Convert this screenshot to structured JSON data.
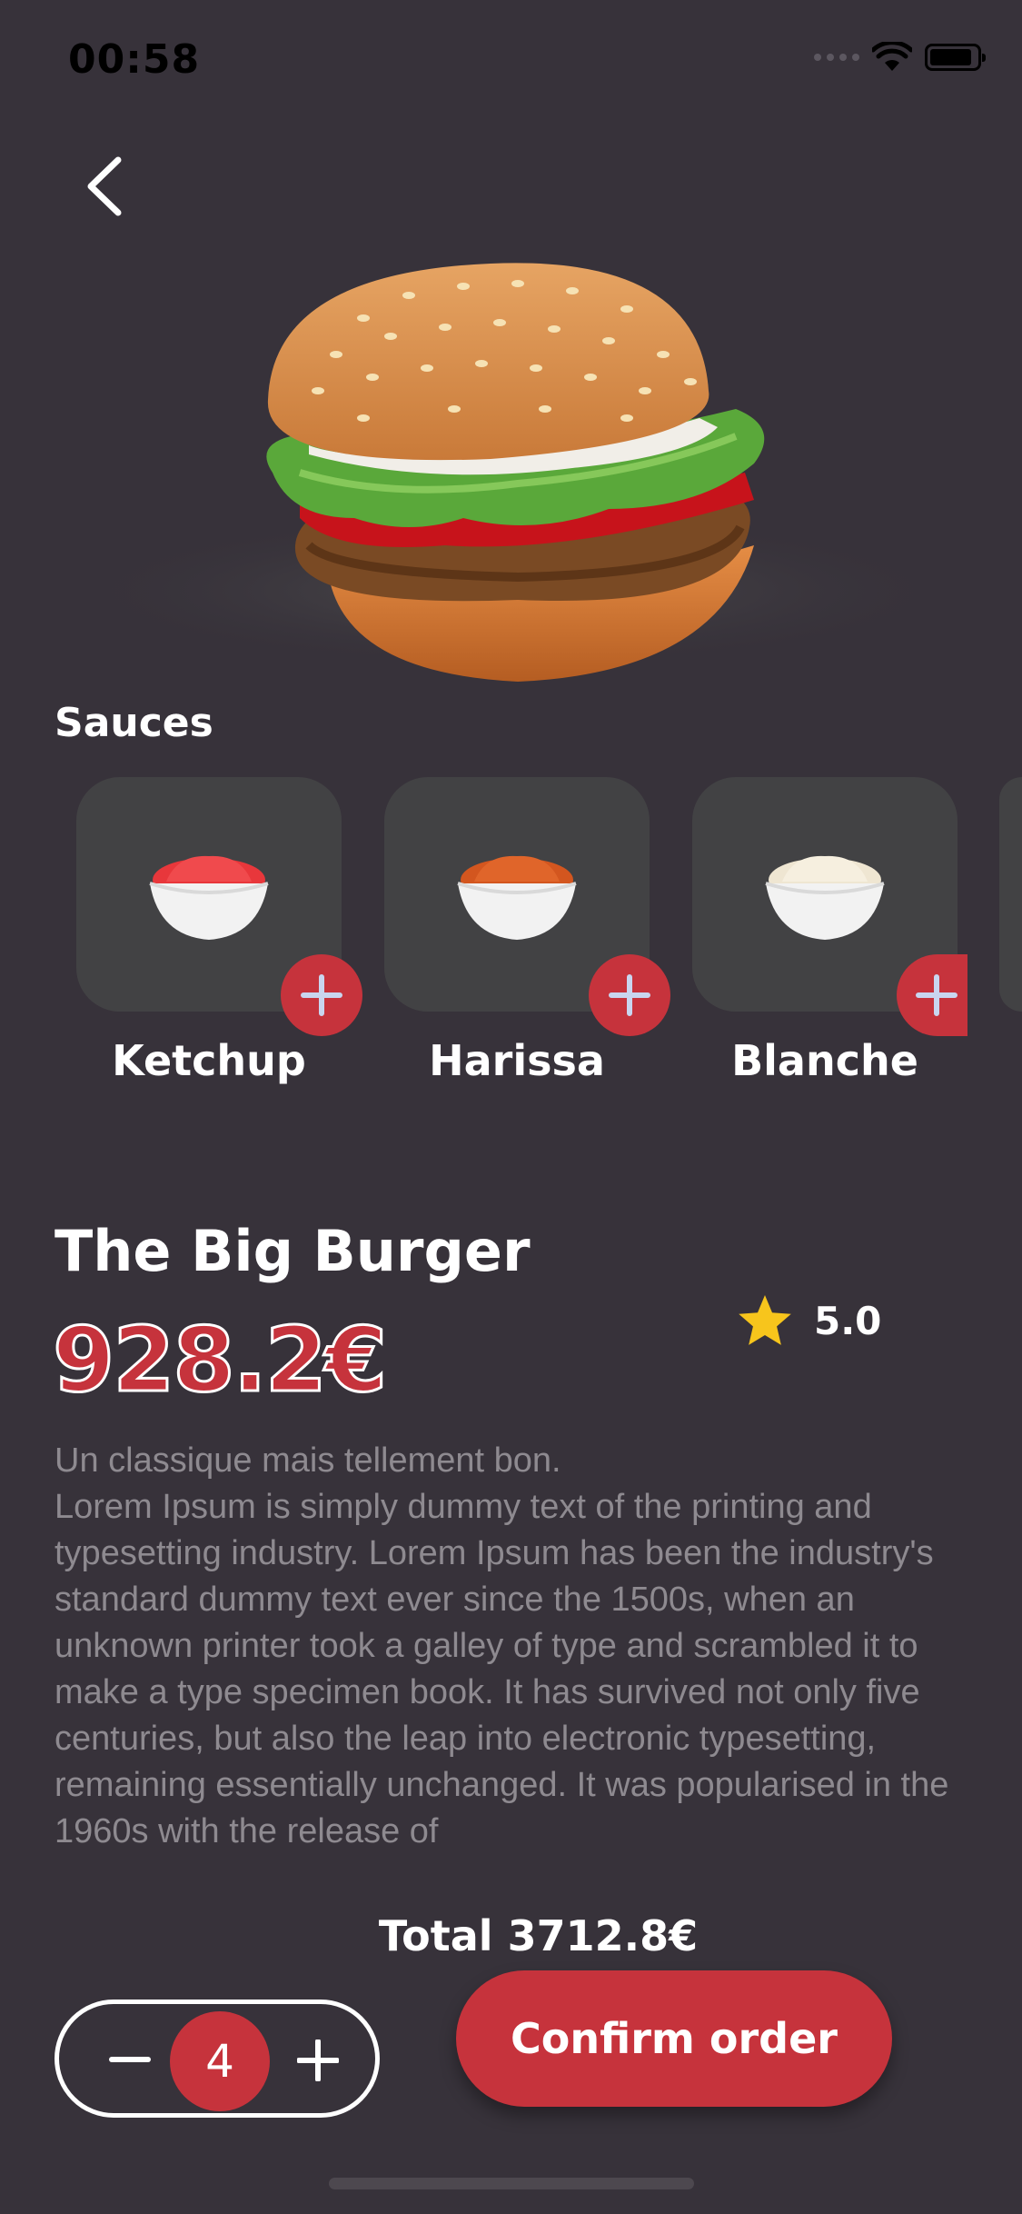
{
  "status_bar": {
    "time": "00:58",
    "icons": [
      "signal-dots-icon",
      "wifi-icon",
      "battery-icon"
    ]
  },
  "nav": {
    "back_icon": "chevron-left-icon"
  },
  "sauces": {
    "title": "Sauces",
    "items": [
      {
        "name": "Ketchup",
        "color": "#e8373b"
      },
      {
        "name": "Harissa",
        "color": "#d3561f"
      },
      {
        "name": "Blanche",
        "color": "#efe6d2"
      }
    ]
  },
  "product": {
    "name": "The Big Burger",
    "price": "928.2€",
    "rating": "5.0",
    "description": "Un classique mais tellement bon.\n Lorem Ipsum is simply dummy text of the printing and typesetting industry. Lorem Ipsum has been the industry's standard dummy text ever since the 1500s, when an unknown printer took a galley of type and scrambled it to make a type specimen book. It has survived not only five centuries, but also the leap into electronic typesetting, remaining essentially unchanged. It was popularised in the 1960s with the release of"
  },
  "order": {
    "total": "Total 3712.8€",
    "quantity": "4",
    "confirm_label": "Confirm order"
  },
  "colors": {
    "background": "#37323a",
    "accent": "#c6333c",
    "card": "#424244",
    "star": "#f7c51c"
  }
}
